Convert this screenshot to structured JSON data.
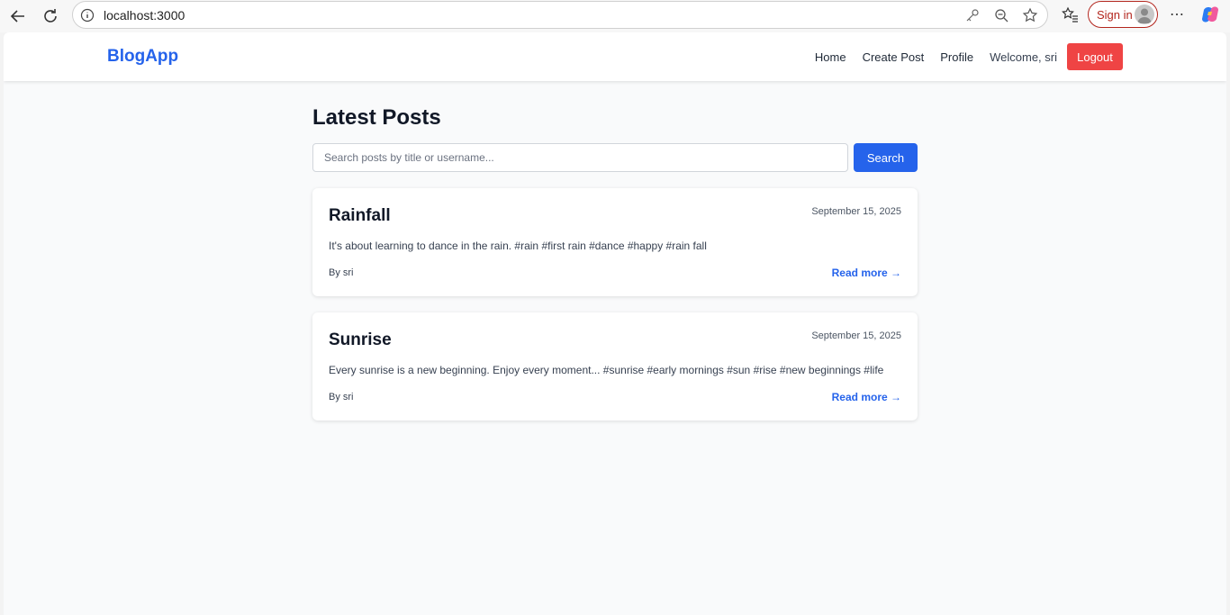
{
  "browser": {
    "url": "localhost:3000",
    "sign_in_label": "Sign in"
  },
  "navbar": {
    "brand": "BlogApp",
    "links": [
      "Home",
      "Create Post",
      "Profile"
    ],
    "welcome": "Welcome, sri",
    "logout_label": "Logout"
  },
  "main": {
    "title": "Latest Posts",
    "search_placeholder": "Search posts by title or username...",
    "search_label": "Search"
  },
  "posts": [
    {
      "title": "Rainfall",
      "date": "September 15, 2025",
      "body": "It's about learning to dance in the rain. #rain #first rain #dance #happy #rain fall",
      "author": "By sri",
      "read_more": "Read more →"
    },
    {
      "title": "Sunrise",
      "date": "September 15, 2025",
      "body": "Every sunrise is a new beginning. Enjoy every moment... #sunrise #early mornings #sun #rise #new beginnings #life",
      "author": "By sri",
      "read_more": "Read more →"
    }
  ],
  "colors": {
    "brand": "#2563eb",
    "primary": "#2563eb",
    "danger": "#ef4444",
    "background": "#f9fafb"
  }
}
